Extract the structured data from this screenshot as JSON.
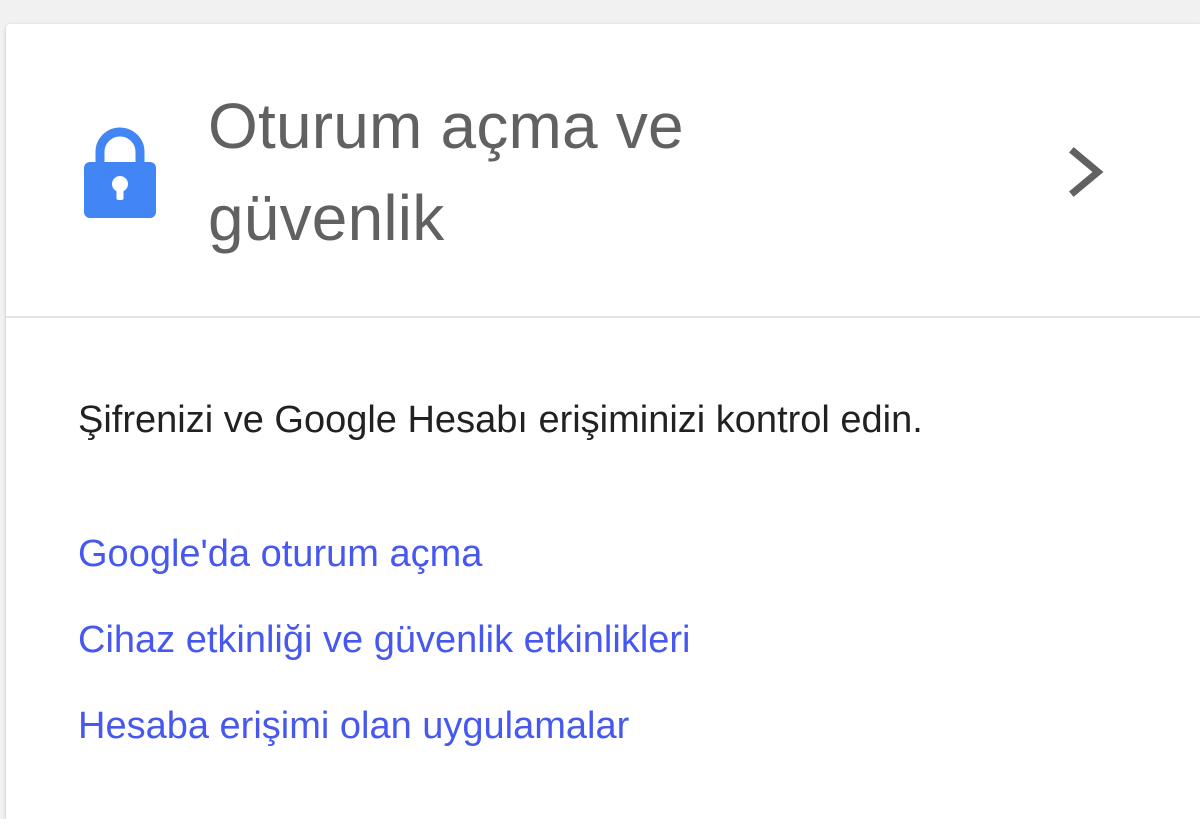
{
  "colors": {
    "accent": "#4285f4",
    "link": "#4758f0",
    "title": "#616161",
    "text": "#212121",
    "divider": "#e3e3e3"
  },
  "card": {
    "icon": "lock-icon",
    "title_line1": "Oturum açma ve",
    "title_line2": "güvenlik",
    "chevron": "chevron-right-icon",
    "description": "Şifrenizi ve Google Hesabı erişiminizi kontrol edin.",
    "links": [
      {
        "label": "Google'da oturum açma"
      },
      {
        "label": "Cihaz etkinliği ve güvenlik etkinlikleri"
      },
      {
        "label": "Hesaba erişimi olan uygulamalar"
      }
    ]
  }
}
